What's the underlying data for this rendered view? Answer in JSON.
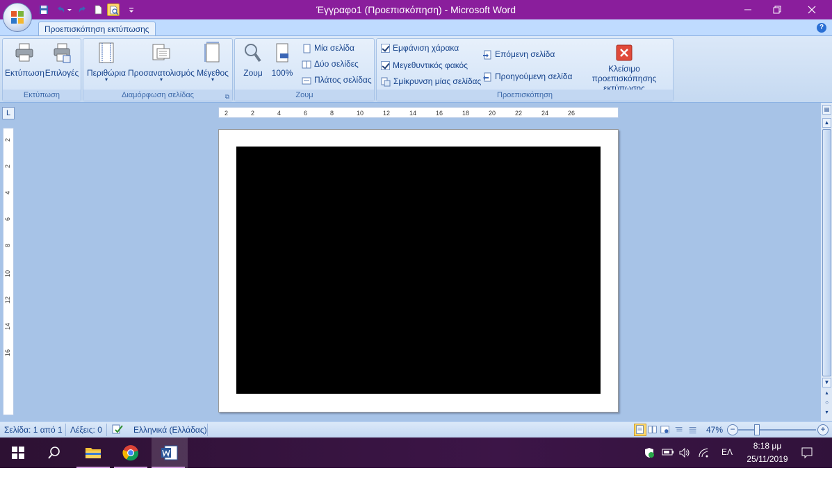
{
  "window": {
    "title": "Έγγραφο1 (Προεπισκόπηση) - Microsoft Word"
  },
  "ribbon": {
    "tab": "Προεπισκόπηση εκτύπωσης",
    "groups": {
      "print": {
        "label": "Εκτύπωση",
        "print_btn": "Εκτύπωση",
        "options_btn": "Επιλογές"
      },
      "page_setup": {
        "label": "Διαμόρφωση σελίδας",
        "margins_btn": "Περιθώρια",
        "orientation_btn": "Προσανατολισμός",
        "size_btn": "Μέγεθος"
      },
      "zoom": {
        "label": "Ζουμ",
        "zoom_btn": "Ζουμ",
        "percent_btn": "100%",
        "one_page": "Μία σελίδα",
        "two_pages": "Δύο σελίδες",
        "page_width": "Πλάτος σελίδας"
      },
      "preview": {
        "label": "Προεπισκόπηση",
        "show_ruler": "Εμφάνιση χάρακα",
        "magnifier": "Μεγεθυντικός φακός",
        "shrink_one_page": "Σμίκρυνση μίας σελίδας",
        "next_page": "Επόμενη σελίδα",
        "previous_page": "Προηγούμενη σελίδα",
        "close_line1": "Κλείσιμο προεπισκόπησης",
        "close_line2": "εκτύπωσης"
      }
    }
  },
  "rulers": {
    "horizontal_ticks": [
      "2",
      "2",
      "4",
      "6",
      "8",
      "10",
      "12",
      "14",
      "16",
      "18",
      "20",
      "22",
      "24",
      "26"
    ],
    "vertical_ticks": [
      "2",
      "2",
      "4",
      "6",
      "8",
      "10",
      "12",
      "14",
      "16"
    ]
  },
  "status": {
    "page": "Σελίδα: 1 από 1",
    "words": "Λέξεις: 0",
    "language": "Ελληνικά (Ελλάδας)",
    "zoom": "47%",
    "zoom_minus": "−",
    "zoom_plus": "+"
  },
  "taskbar": {
    "lang": "ΕΛ",
    "time": "8:18 μμ",
    "date": "25/11/2019"
  },
  "colors": {
    "titlebar": "#8a1e9c",
    "ribbon": "#c5d9f1",
    "workspace": "#a7c3e7",
    "taskbar": "#3c1547"
  }
}
